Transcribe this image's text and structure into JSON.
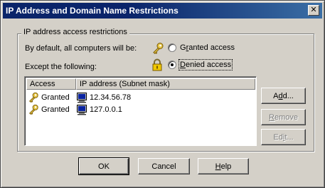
{
  "window": {
    "title": "IP Address and Domain Name Restrictions",
    "close_glyph": "✕"
  },
  "group": {
    "legend": "IP address access restrictions",
    "default_label": "By default, all computers will be:",
    "except_label": "Except the following:",
    "options": [
      {
        "label_pre": "G",
        "label_mnemonic": "r",
        "label_post": "anted access",
        "icon": "key-icon",
        "checked": false
      },
      {
        "label_pre": "",
        "label_mnemonic": "D",
        "label_post": "enied access",
        "icon": "lock-icon",
        "checked": true
      }
    ]
  },
  "list": {
    "columns": [
      "Access",
      "IP address (Subnet mask)"
    ],
    "rows": [
      {
        "access": "Granted",
        "ip": "12.34.56.78",
        "access_icon": "key-icon",
        "ip_icon": "computer-icon"
      },
      {
        "access": "Granted",
        "ip": "127.0.0.1",
        "access_icon": "key-icon",
        "ip_icon": "computer-icon"
      }
    ]
  },
  "side_buttons": {
    "add": {
      "pre": "A",
      "mn": "d",
      "post": "d..."
    },
    "remove": {
      "pre": "",
      "mn": "R",
      "post": "emove"
    },
    "edit": {
      "pre": "Ed",
      "mn": "i",
      "post": "t..."
    }
  },
  "footer": {
    "ok": "OK",
    "cancel": "Cancel",
    "help": {
      "pre": "",
      "mn": "H",
      "post": "elp"
    }
  }
}
